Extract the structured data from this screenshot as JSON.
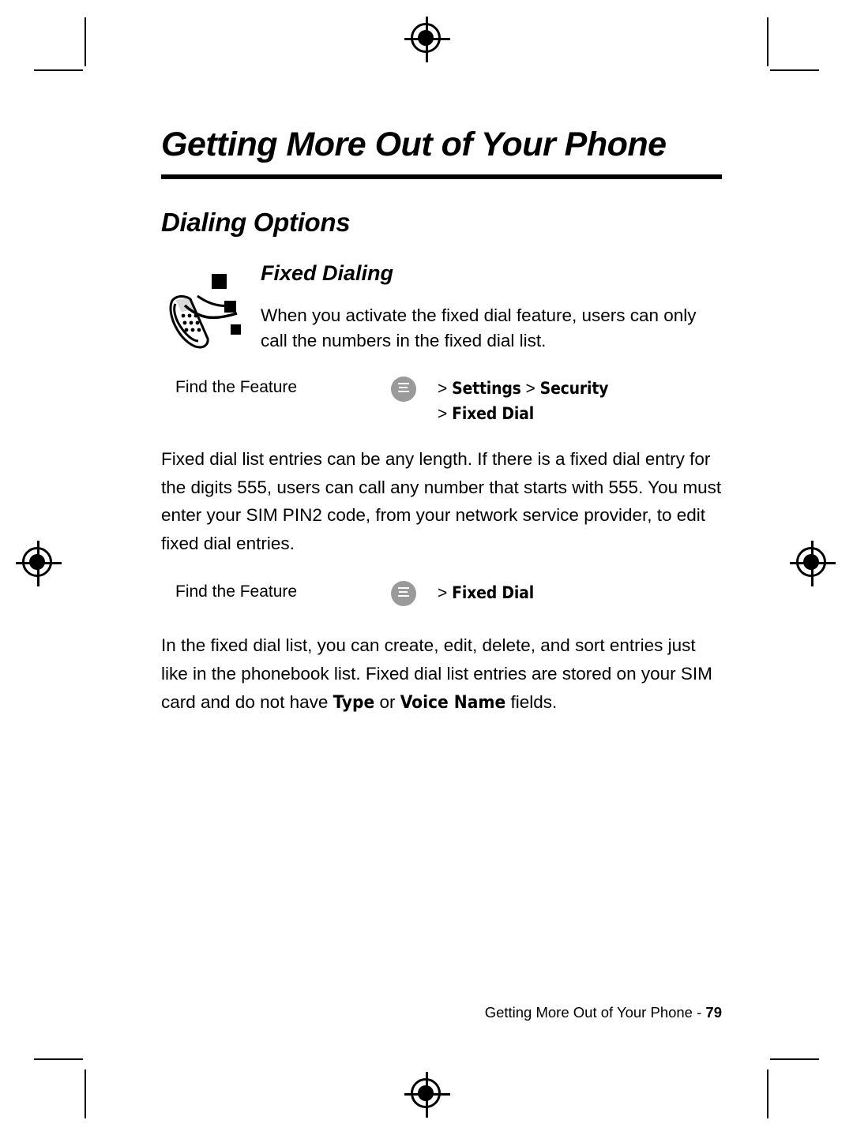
{
  "document": {
    "chapter_title": "Getting More Out of Your Phone",
    "section_title": "Dialing Options",
    "subsection": {
      "title": "Fixed Dialing",
      "icon": "phone-with-keys-icon",
      "intro": "When you activate the fixed dial feature, users can only call the numbers in the fixed dial list."
    },
    "find_feature_1": {
      "label": "Find the Feature",
      "key_icon": "menu-key-icon",
      "arrow1": ">",
      "item1": "Settings",
      "arrow2": ">",
      "item2": "Security",
      "arrow3": ">",
      "item3": "Fixed Dial"
    },
    "paragraph_1": "Fixed dial list entries can be any length. If there is a fixed dial entry for the digits 555, users can call any number that starts with 555. You must enter your SIM PIN2 code, from your network service provider, to edit fixed dial entries.",
    "find_feature_2": {
      "label": "Find the Feature",
      "key_icon": "menu-key-icon",
      "arrow1": ">",
      "item1": "Fixed Dial"
    },
    "paragraph_2": {
      "part1": "In the fixed dial list, you can create, edit, delete, and sort entries just like in the phonebook list. Fixed dial list entries are stored on your SIM card and do not have ",
      "field1": "Type",
      "part2": " or ",
      "field2": "Voice Name",
      "part3": " fields."
    },
    "footer": {
      "text": "Getting More Out of Your Phone - ",
      "page_number": "79"
    }
  }
}
